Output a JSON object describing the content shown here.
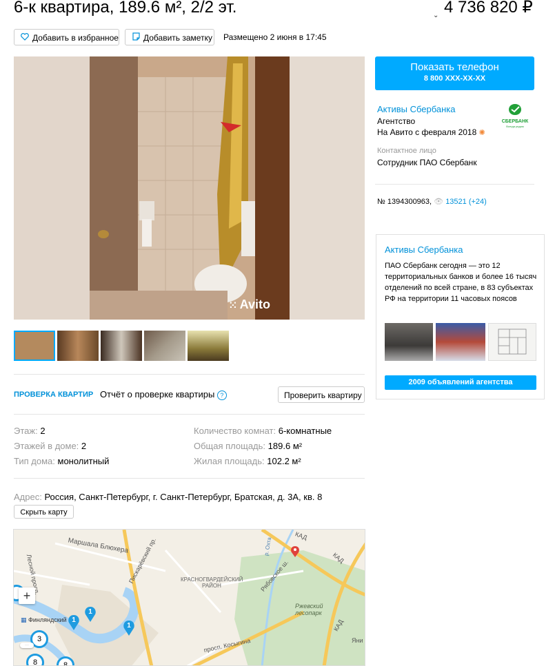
{
  "header": {
    "title": "6-к квартира, 189.6 м², 2/2 эт.",
    "price": "4 736 820 ₽"
  },
  "actions": {
    "favorite_label": "Добавить в избранное",
    "note_label": "Добавить заметку",
    "posted": "Размещено 2 июня в 17:45"
  },
  "photo": {
    "watermark": "Avito"
  },
  "seller": {
    "phone_label": "Показать телефон",
    "phone_number": "8 800 XXX-XX-XX",
    "name": "Активы Сбербанка",
    "type": "Агентство",
    "since": "На Авито с февраля 2018",
    "logo_text": "СБЕРБАНК",
    "logo_subtext": "Всегда рядом",
    "contact_caption": "Контактное лицо",
    "contact_name": "Сотрудник ПАО Сбербанк",
    "listing_id": "№ 1394300963,",
    "views": "13521 (+24)"
  },
  "agency_card": {
    "title": "Активы Сбербанка",
    "description": "ПАО Сбербанк сегодня — это 12 территориальных банков и более 16 тысяч отделений по всей стране, в 83 субъектах РФ на территории 11 часовых поясов",
    "button_label": "2009 объявлений агентства"
  },
  "check": {
    "tag": "ПРОВЕРКА КВАРТИР",
    "report_label": "Отчёт о проверке квартиры",
    "help_icon": "?",
    "button_label": "Проверить квартиру"
  },
  "params": {
    "floor_key": "Этаж:",
    "floor_val": "2",
    "floors_key": "Этажей в доме:",
    "floors_val": "2",
    "house_key": "Тип дома:",
    "house_val": "монолитный",
    "rooms_key": "Количество комнат:",
    "rooms_val": "6-комнатные",
    "total_key": "Общая площадь:",
    "total_val": "189.6 м²",
    "living_key": "Жилая площадь:",
    "living_val": "102.2 м²"
  },
  "address": {
    "key": "Адрес:",
    "value": "Россия, Санкт-Петербург, г. Санкт-Петербург, Братская, д. 3А, кв. 8",
    "hide_map_label": "Скрыть карту"
  },
  "map": {
    "labels": [
      "Маршала Блюхера",
      "Пискарёвский пр.",
      "Лесной просп.",
      "КРАСНОГВАРДЕЙСКИЙ РАЙОН",
      "Рябовское ш.",
      "Ржевский лесопарк",
      "КАД",
      "КАД",
      "КАД",
      "Финляндский вкз.",
      "просп. Косыгина",
      "Яни",
      "р. Охта"
    ],
    "clusters": [
      "1",
      "1",
      "1",
      "3",
      "8",
      "8"
    ],
    "zoom_in": "+"
  },
  "colors": {
    "accent": "#00aaff",
    "link": "#0091d9",
    "sber_green": "#21a038"
  }
}
